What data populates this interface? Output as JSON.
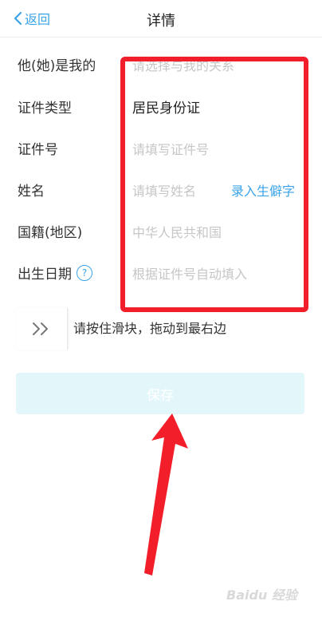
{
  "navbar": {
    "back_icon": "chevron-left-icon",
    "back_label": "返回",
    "title": "详情"
  },
  "form": {
    "relation": {
      "label": "他(她)是我的",
      "placeholder": "请选择与我的关系"
    },
    "id_type": {
      "label": "证件类型",
      "value": "居民身份证"
    },
    "id_number": {
      "label": "证件号",
      "placeholder": "请填写证件号"
    },
    "name": {
      "label": "姓名",
      "placeholder": "请填写姓名",
      "action_label": "录入生僻字"
    },
    "nationality": {
      "label": "国籍(地区)",
      "placeholder": "中华人民共和国"
    },
    "birth_date": {
      "label": "出生日期",
      "help_icon": "question-circle-icon",
      "help_glyph": "?",
      "placeholder": "根据证件号自动填入"
    }
  },
  "slider": {
    "handle_icon": "double-chevron-right-icon",
    "instruction": "请按住滑块，拖动到最右边"
  },
  "save_label": "保存",
  "watermark": "Baidu 经验",
  "colors": {
    "accent": "#3ba3e8",
    "annotation": "#f21f2a",
    "save_button_bg": "#e3f7fb",
    "placeholder": "#c6c6c6"
  }
}
